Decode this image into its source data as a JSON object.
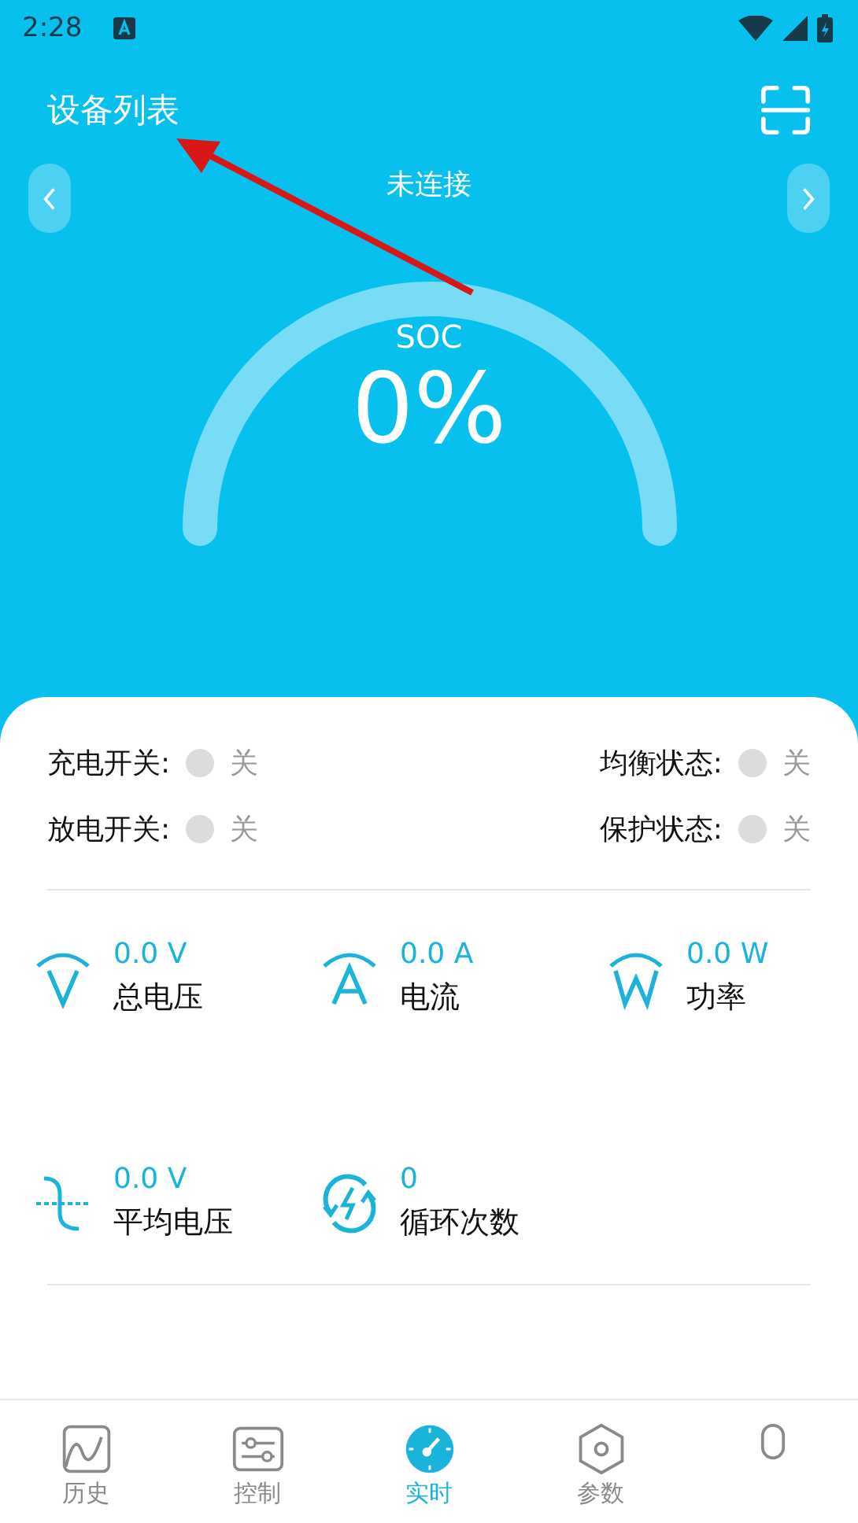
{
  "status_bar": {
    "time": "2:28"
  },
  "header": {
    "title": "设备列表"
  },
  "device": {
    "status": "未连接"
  },
  "gauge": {
    "label": "SOC",
    "value": "0%"
  },
  "switches": [
    {
      "label": "充电开关:",
      "state_text": "关",
      "on": false
    },
    {
      "label": "均衡状态:",
      "state_text": "关",
      "on": false
    },
    {
      "label": "放电开关:",
      "state_text": "关",
      "on": false
    },
    {
      "label": "保护状态:",
      "state_text": "关",
      "on": false
    }
  ],
  "metrics": [
    {
      "kind": "voltage",
      "value": "0.0 V",
      "label": "总电压"
    },
    {
      "kind": "current",
      "value": "0.0 A",
      "label": "电流"
    },
    {
      "kind": "power",
      "value": "0.0 W",
      "label": "功率"
    },
    {
      "kind": "average",
      "value": "0.0 V",
      "label": "平均电压"
    },
    {
      "kind": "cycles",
      "value": "0",
      "label": "循环次数"
    }
  ],
  "tabs": [
    {
      "kind": "history",
      "label": "历史",
      "selected": false
    },
    {
      "kind": "control",
      "label": "控制",
      "selected": false
    },
    {
      "kind": "realtime",
      "label": "实时",
      "selected": true
    },
    {
      "kind": "params",
      "label": "参数",
      "selected": false
    },
    {
      "kind": "device",
      "selected": false
    }
  ]
}
